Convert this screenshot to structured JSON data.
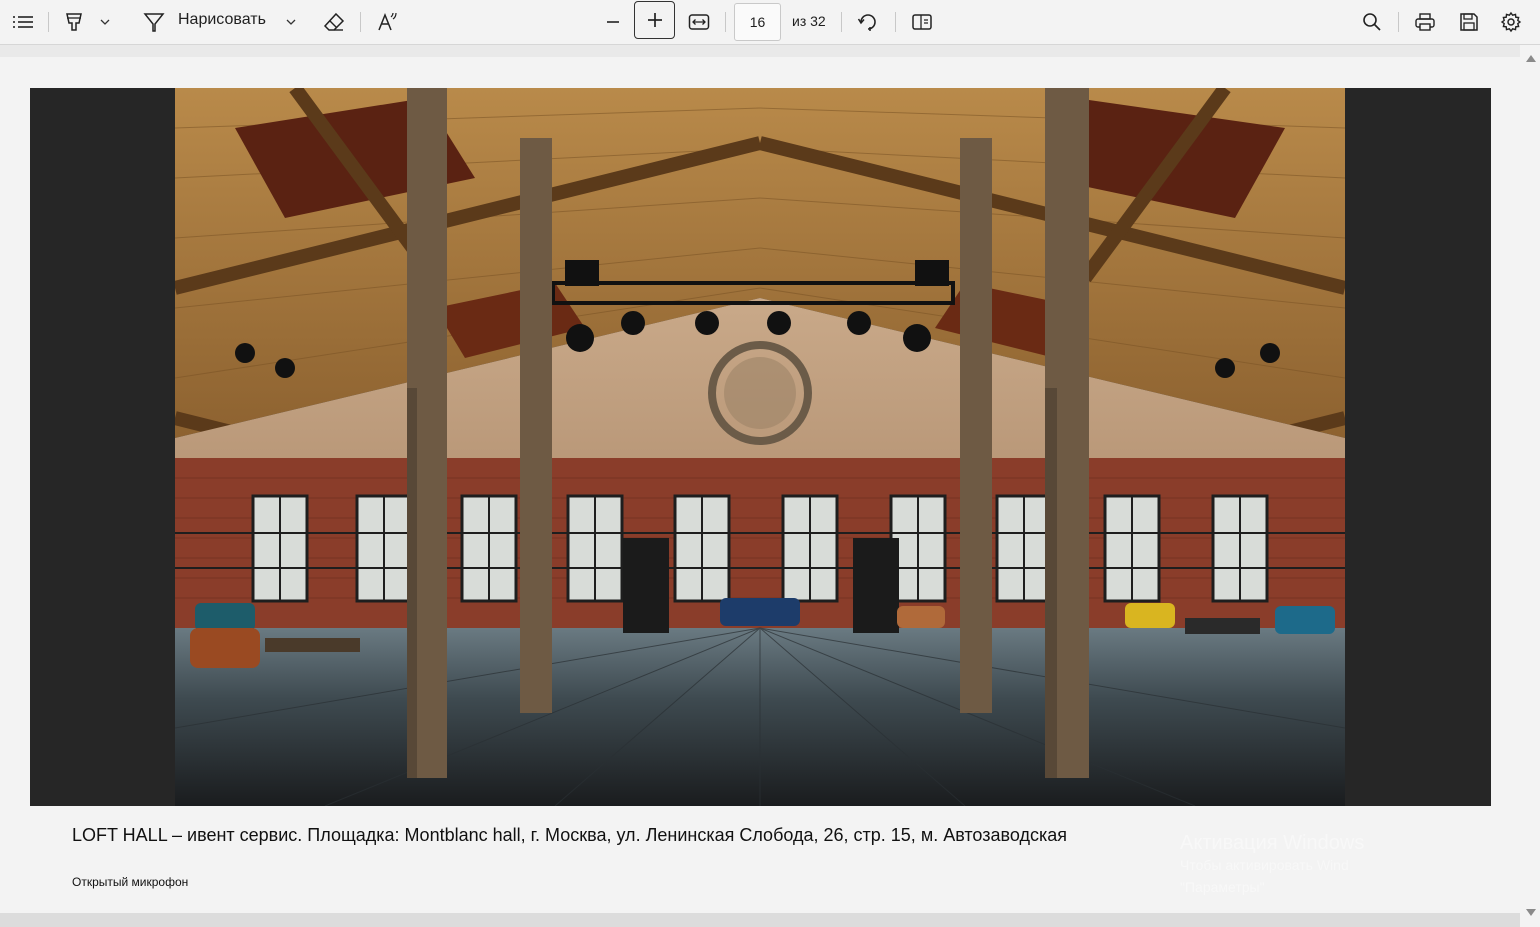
{
  "toolbar": {
    "draw_label": "Нарисовать",
    "page_current": "16",
    "page_total": "из 32"
  },
  "document": {
    "caption": "LOFT HALL – ивент сервис. Площадка: Montblanc hall, г. Москва, ул. Ленинская Слобода, 26, стр. 15, м. Автозаводская",
    "note": "Открытый микрофон"
  },
  "watermark": {
    "line1": "Активация Windows",
    "line2": "Чтобы активировать Wind",
    "line3": "\"Параметры\""
  }
}
